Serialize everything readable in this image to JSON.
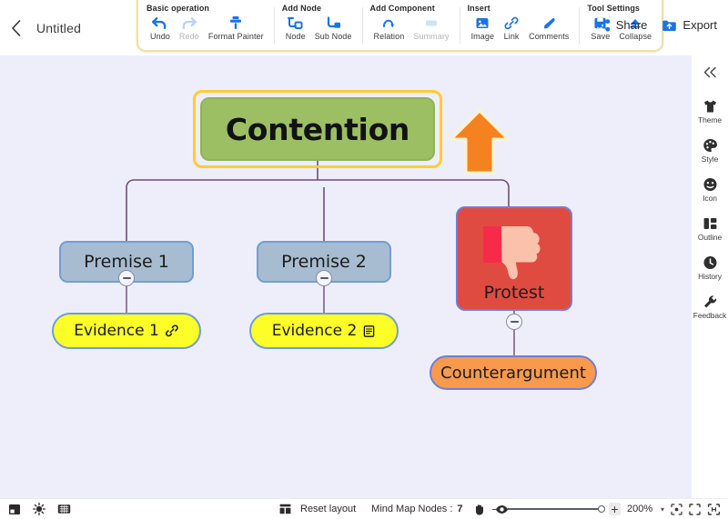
{
  "header": {
    "back_icon": "chevron-left-icon",
    "title": "Untitled",
    "share_label": "Share",
    "share_icon": "share-icon",
    "export_label": "Export",
    "export_icon": "export-folder-icon"
  },
  "toolbar": {
    "groups": [
      {
        "title": "Basic operation",
        "items": [
          {
            "label": "Undo",
            "icon": "undo-arrow-icon",
            "disabled": false
          },
          {
            "label": "Redo",
            "icon": "redo-arrow-icon",
            "disabled": true
          },
          {
            "label": "Format Painter",
            "icon": "format-painter-icon",
            "disabled": false
          }
        ]
      },
      {
        "title": "Add Node",
        "items": [
          {
            "label": "Node",
            "icon": "add-node-icon",
            "disabled": false
          },
          {
            "label": "Sub Node",
            "icon": "add-sub-node-icon",
            "disabled": false
          }
        ]
      },
      {
        "title": "Add Component",
        "items": [
          {
            "label": "Relation",
            "icon": "relation-icon",
            "disabled": false
          },
          {
            "label": "Summary",
            "icon": "summary-icon",
            "disabled": true
          }
        ]
      },
      {
        "title": "Insert",
        "items": [
          {
            "label": "Image",
            "icon": "image-icon",
            "disabled": false
          },
          {
            "label": "Link",
            "icon": "link-icon",
            "disabled": false
          },
          {
            "label": "Comments",
            "icon": "comments-pen-icon",
            "disabled": false
          }
        ]
      },
      {
        "title": "Tool Settings",
        "items": [
          {
            "label": "Save",
            "icon": "save-disk-icon",
            "disabled": false
          },
          {
            "label": "Collapse",
            "icon": "collapse-icon",
            "disabled": false
          }
        ]
      }
    ]
  },
  "sidebar": {
    "collapse_icon": "double-chevron-left-icon",
    "items": [
      {
        "label": "Theme",
        "icon": "theme-shirt-icon"
      },
      {
        "label": "Style",
        "icon": "style-palette-icon"
      },
      {
        "label": "Icon",
        "icon": "smiley-face-icon"
      },
      {
        "label": "Outline",
        "icon": "outline-layout-icon"
      },
      {
        "label": "History",
        "icon": "clock-history-icon"
      },
      {
        "label": "Feedback",
        "icon": "wrench-feedback-icon"
      }
    ]
  },
  "mindmap": {
    "root": {
      "label": "Contention",
      "color": "#9cbf64",
      "selected": true
    },
    "nodes": [
      {
        "label": "Premise 1",
        "color": "#a7bcd0",
        "type": "premise"
      },
      {
        "label": "Premise 2",
        "color": "#a7bcd0",
        "type": "premise"
      },
      {
        "label": "Evidence 1",
        "color": "#fdfd27",
        "type": "evidence",
        "badge_icon": "link-chain-icon"
      },
      {
        "label": "Evidence 2",
        "color": "#fdfd27",
        "type": "evidence",
        "badge_icon": "note-comment-icon"
      },
      {
        "label": "Protest",
        "color": "#e04b41",
        "type": "image-node",
        "image_icon": "thumbs-down-icon"
      },
      {
        "label": "Counterargument",
        "color": "#f79a4e",
        "type": "counter"
      }
    ],
    "annotation_arrow": {
      "icon": "up-arrow-annotation",
      "color": "#f58220"
    }
  },
  "statusbar": {
    "left_icons": [
      {
        "icon": "panel-layout-icon"
      },
      {
        "icon": "brightness-sun-icon"
      },
      {
        "icon": "grid-keyboard-icon"
      }
    ],
    "reset_layout_label": "Reset layout",
    "reset_layout_icon": "reset-layout-icon",
    "node_count_label": "Mind Map Nodes :",
    "node_count_value": "7",
    "hand_icon": "hand-pan-icon",
    "eye_icon": "eye-visibility-icon",
    "zoom_out_label": "−",
    "zoom_in_label": "+",
    "zoom_value": "200%",
    "zoom_caret": "▾",
    "fit_icons": [
      {
        "icon": "center-focus-icon"
      },
      {
        "icon": "fit-screen-icon"
      },
      {
        "icon": "fit-width-icon"
      }
    ]
  }
}
